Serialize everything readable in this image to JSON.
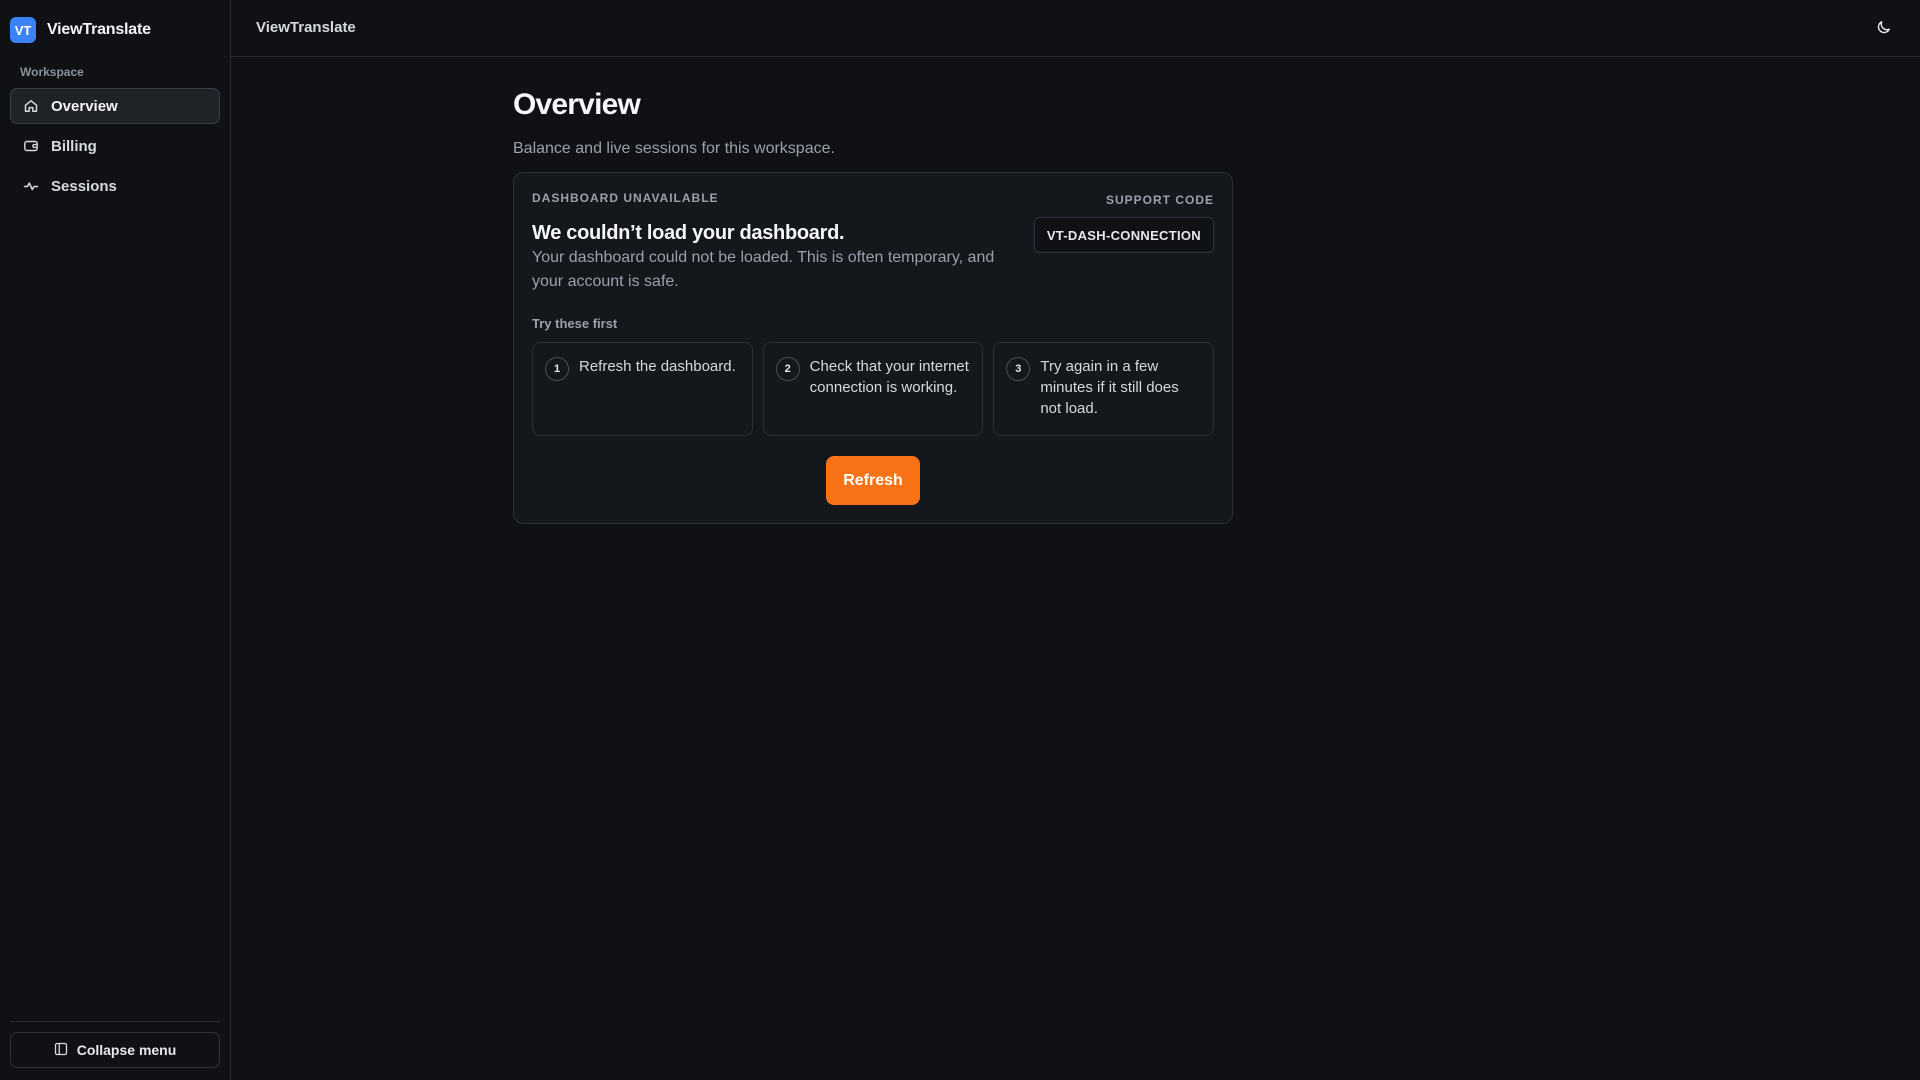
{
  "brand": {
    "logo_text": "VT",
    "name": "ViewTranslate",
    "logo_color": "#3b82f6"
  },
  "sidebar": {
    "section_label": "Workspace",
    "items": [
      {
        "label": "Overview",
        "icon": "home-icon",
        "active": true
      },
      {
        "label": "Billing",
        "icon": "wallet-icon",
        "active": false
      },
      {
        "label": "Sessions",
        "icon": "activity-icon",
        "active": false
      }
    ],
    "collapse_label": "Collapse menu"
  },
  "topbar": {
    "title": "ViewTranslate",
    "theme_icon": "moon-icon"
  },
  "page": {
    "title": "Overview",
    "subtitle": "Balance and live sessions for this workspace."
  },
  "error_card": {
    "eyebrow": "DASHBOARD UNAVAILABLE",
    "title": "We couldn’t load your dashboard.",
    "description": "Your dashboard could not be loaded. This is often temporary, and your account is safe.",
    "support_label": "SUPPORT CODE",
    "support_code": "VT-DASH-CONNECTION",
    "tips_label": "Try these first",
    "tips": [
      {
        "number": "1",
        "text": "Refresh the dashboard."
      },
      {
        "number": "2",
        "text": "Check that your internet connection is working."
      },
      {
        "number": "3",
        "text": "Try again in a few minutes if it still does not load."
      }
    ],
    "refresh_label": "Refresh",
    "accent_color": "#f97316"
  }
}
